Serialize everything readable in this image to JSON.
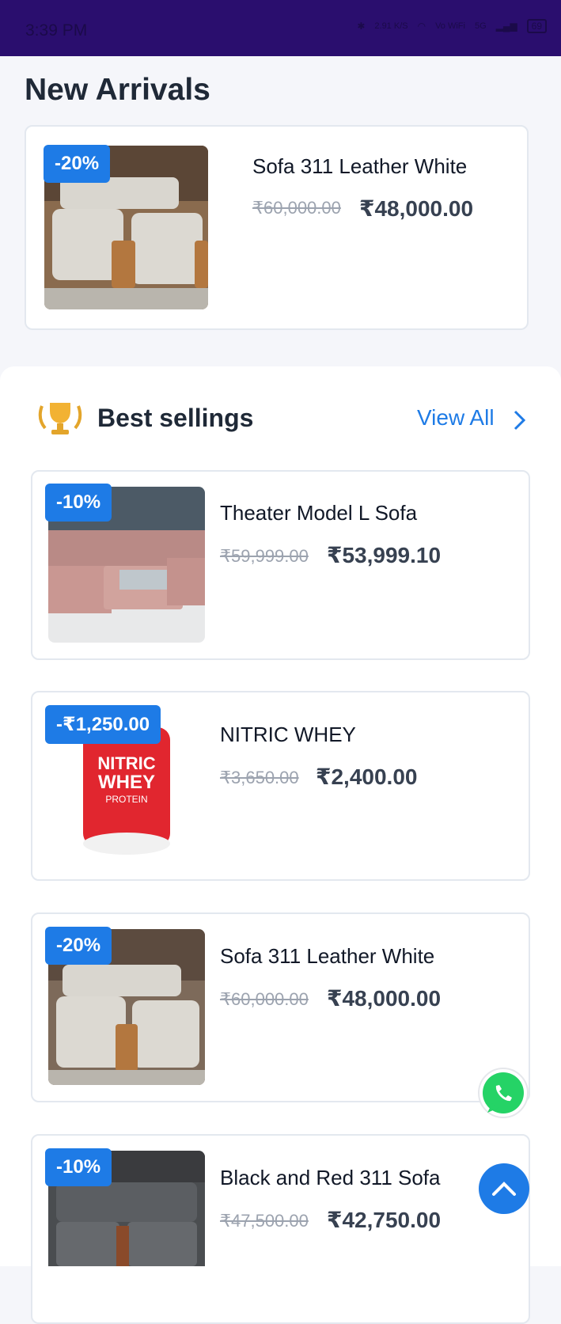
{
  "status_bar": {
    "time": "3:39 PM",
    "net_speed": "2.91 K/S",
    "volte": "Vo WiFi",
    "network": "5G",
    "battery": "69"
  },
  "new_arrivals": {
    "title": "New Arrivals",
    "item": {
      "badge": "-20%",
      "name": "Sofa 311 Leather White",
      "old_price": "₹60,000.00",
      "price": "₹48,000.00"
    }
  },
  "best_sellings": {
    "title": "Best sellings",
    "view_all": "View All",
    "items": [
      {
        "badge": "-10%",
        "name": "Theater Model L Sofa",
        "old_price": "₹59,999.00",
        "price": "₹53,999.10"
      },
      {
        "badge": "-₹1,250.00",
        "name": "NITRIC WHEY",
        "old_price": "₹3,650.00",
        "price": "₹2,400.00"
      },
      {
        "badge": "-20%",
        "name": "Sofa 311 Leather White",
        "old_price": "₹60,000.00",
        "price": "₹48,000.00"
      },
      {
        "badge": "-10%",
        "name": "Black and Red 311 Sofa",
        "old_price": "₹47,500.00",
        "price": "₹42,750.00"
      }
    ]
  },
  "product_label_text": {
    "nitric": "NITRIC",
    "whey": "WHEY",
    "protein": "PROTEIN"
  },
  "colors": {
    "accent": "#1e7be6",
    "status_bar": "#2a0e6e",
    "whatsapp": "#25d366"
  }
}
